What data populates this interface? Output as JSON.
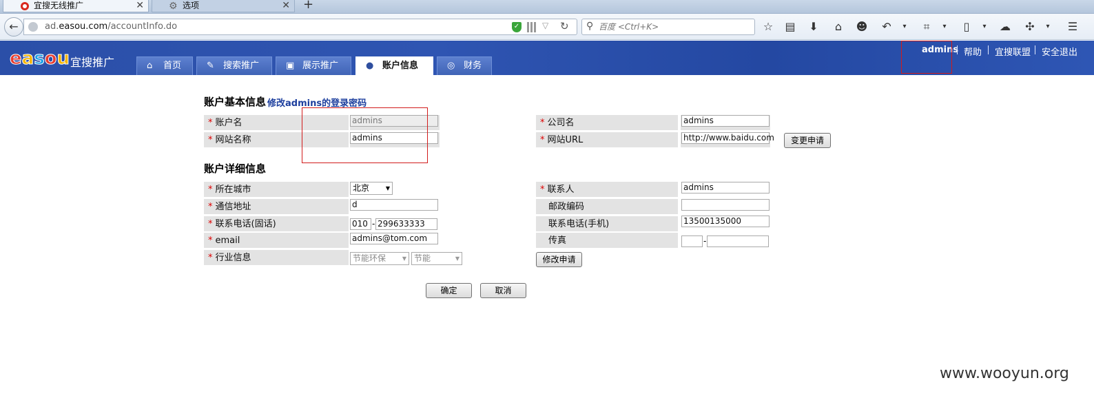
{
  "browser": {
    "tabs": [
      {
        "label": "宜搜无线推广",
        "active": true
      },
      {
        "label": "选项",
        "active": false
      }
    ],
    "url_prefix": "ad.",
    "url_domain": "easou.com",
    "url_path": "/accountInfo.do",
    "search_placeholder": "百度 <Ctrl+K>"
  },
  "site": {
    "logo_letters": [
      "e",
      "a",
      "s",
      "o",
      "u"
    ],
    "logo_colors": [
      "#e73c2f",
      "#f7b500",
      "#1aa0e8",
      "#e73c2f",
      "#f7b500"
    ],
    "logo_text": "宜搜推广",
    "nav_tabs": [
      {
        "label": "首页",
        "icon": "home-icon"
      },
      {
        "label": "搜索推广",
        "icon": "edit-icon"
      },
      {
        "label": "展示推广",
        "icon": "image-icon"
      },
      {
        "label": "账户信息",
        "icon": "user-icon"
      },
      {
        "label": "财务",
        "icon": "coins-icon"
      }
    ],
    "top_links": {
      "user": "admins",
      "help": "帮助",
      "union": "宜搜联盟",
      "logout": "安全退出"
    }
  },
  "form": {
    "basic_title": "账户基本信息",
    "change_pwd_link": "修改admins的登录密码",
    "detail_title": "账户详细信息",
    "account_name_label": "账户名",
    "account_name_value": "admins",
    "site_name_label": "网站名称",
    "site_name_value": "admins",
    "company_label": "公司名",
    "company_value": "admins",
    "site_url_label": "网站URL",
    "site_url_value": "http://www.baidu.com",
    "change_request_button": "变更申请",
    "city_label": "所在城市",
    "city_value": "北京",
    "address_label": "通信地址",
    "address_value": "d",
    "phone_label": "联系电话(固话)",
    "phone_area": "010",
    "phone_number": "299633333",
    "email_label": "email",
    "email_value": "admins@tom.com",
    "industry_label": "行业信息",
    "industry_main": "节能环保",
    "industry_sub": "节能",
    "contact_label": "联系人",
    "contact_value": "admins",
    "zip_label": "邮政编码",
    "zip_value": "",
    "mobile_label": "联系电话(手机)",
    "mobile_value": "13500135000",
    "fax_label": "传真",
    "fax_area": "",
    "fax_number": "",
    "modify_request_button": "修改申请",
    "ok_button": "确定",
    "cancel_button": "取消",
    "required_mark": "*",
    "dash": "-"
  },
  "watermark": "www.wooyun.org"
}
